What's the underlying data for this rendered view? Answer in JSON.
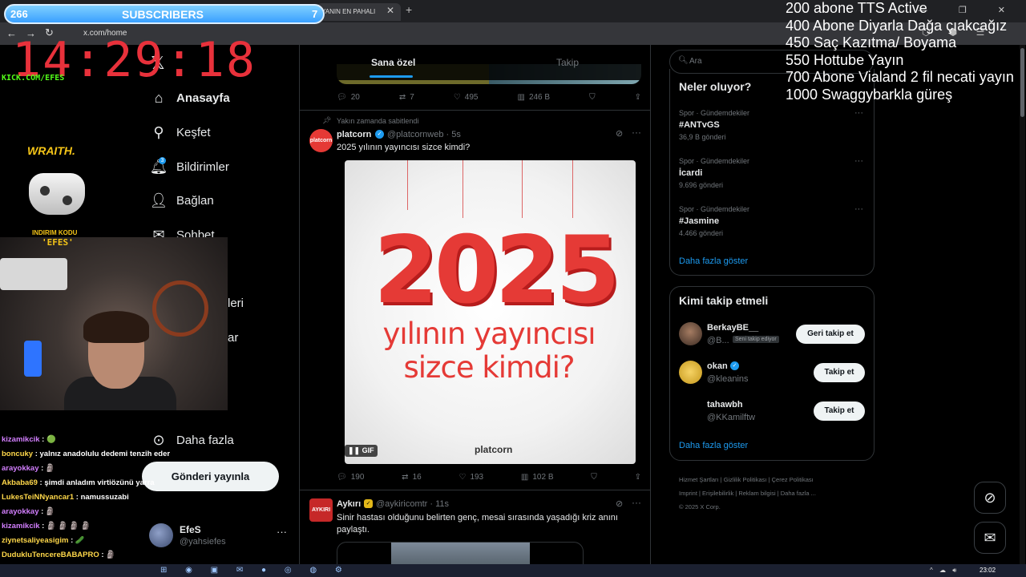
{
  "browser": {
    "tab_title": "YANIN EN PAHALI",
    "url": "x.com/home"
  },
  "overlay": {
    "sub_count": "266",
    "sub_label": "SUBSCRIBERS",
    "sub_right": "7",
    "clock": "14:29:18",
    "kick": "KICK.COM/EFES",
    "wraith": "WRAITH.",
    "promo_label": "INDIRIM KODU",
    "promo_code": "'EFES'",
    "tts_lines": [
      "200 abone TTS Active",
      "400 Abone Diyarla Dağa çıakcağız",
      "450 Saç Kazıtma/ Boyama",
      "550 Hottube Yayın",
      "700 Abone Vialand 2 fil necati yayın",
      "1000 Swaggybarkla güreş"
    ],
    "chat": [
      {
        "user": "kizamikcik",
        "msg": " : 🟢",
        "y": false
      },
      {
        "user": "boncuky",
        "msg": " : yalnız anadolulu dedemi tenzih eder misin",
        "y": true
      },
      {
        "user": "arayokkay",
        "msg": " : 🗿",
        "y": false
      },
      {
        "user": "Akbaba69",
        "msg": " : şimdi anladım virtiözünü yarra",
        "y": true
      },
      {
        "user": "LukesTeiNNyancar1",
        "msg": " : namussuzabi",
        "y": true
      },
      {
        "user": "arayokkay",
        "msg": " : 🗿",
        "y": false
      },
      {
        "user": "kizamikcik",
        "msg": " : 🗿 🗿 🗿 🗿",
        "y": false
      },
      {
        "user": "ziynetsaliyeasigim",
        "msg": " : 🥒",
        "y": true
      },
      {
        "user": "DudukluTencereBABAPRO",
        "msg": " : 🗿",
        "y": true
      },
      {
        "user": "arayokkay",
        "msg": "",
        "y": false
      }
    ]
  },
  "nav": {
    "home": "Anasayfa",
    "explore": "Keşfet",
    "notifications": "Bildirimler",
    "notif_count": "3",
    "connect": "Bağlan",
    "chat": "Sohbet",
    "partial1": "leri",
    "partial2": "ar",
    "more": "Daha fazla",
    "post": "Gönderi yayınla",
    "me_name": "EfeS",
    "me_handle": "@yahsiefes"
  },
  "feed": {
    "tab_foryou": "Sana özel",
    "tab_following": "Takip",
    "prev_actions": {
      "replies": "20",
      "reposts": "7",
      "likes": "495",
      "views": "246 B"
    },
    "pinned_label": "Yakın zamanda sabitlendi",
    "post1": {
      "name": "platcorn",
      "handle": "@platcornweb · 5s",
      "text": "2025 yılının yayıncısı sizce kimdi?",
      "avatar_text": "platcorn",
      "media_big": "2025",
      "media_line1": "yılının yayıncısı",
      "media_line2": "sizce kimdi?",
      "media_logo": "platcorn",
      "gif": "GIF",
      "replies": "190",
      "reposts": "16",
      "likes": "193",
      "views": "102 B"
    },
    "post2": {
      "name": "Aykırı",
      "handle": "@aykiricomtr · 11s",
      "avatar_text": "AYKIRI",
      "text": "Sinir hastası olduğunu belirten genç, mesai sırasında yaşadığı kriz anını paylaştı."
    }
  },
  "sidebar": {
    "search_placeholder": "Ara",
    "trends_title": "Neler oluyor?",
    "trends": [
      {
        "cat": "Spor · Gündemdekiler",
        "name": "#ANTvGS",
        "count": "36,9 B gönderi"
      },
      {
        "cat": "Spor · Gündemdekiler",
        "name": "İcardi",
        "count": "9.696 gönderi"
      },
      {
        "cat": "Spor · Gündemdekiler",
        "name": "#Jasmine",
        "count": "4.466 gönderi"
      }
    ],
    "show_more": "Daha fazla göster",
    "wtf_title": "Kimi takip etmeli",
    "wtf": [
      {
        "name": "BerkayBE__",
        "handle": "@B...",
        "badge": "Seni takip ediyor",
        "button": "Geri takip et"
      },
      {
        "name": "okan",
        "handle": "@kleanins",
        "button": "Takip et"
      },
      {
        "name": "tahawbh",
        "handle": "@KKamilftw",
        "button": "Takip et"
      }
    ],
    "wtf_more": "Daha fazla göster",
    "footer": [
      "Hizmet Şartları",
      "Gizlilik Politikası",
      "Çerez Politikası",
      "Imprint",
      "Erişilebilirlik",
      "Reklam bilgisi",
      "Daha fazla ...",
      "© 2025 X Corp."
    ]
  },
  "taskbar": {
    "time": "23:02"
  },
  "colors": {
    "accent": "#1d9bf0",
    "clock": "#e8313b",
    "kick": "#53fc18"
  }
}
